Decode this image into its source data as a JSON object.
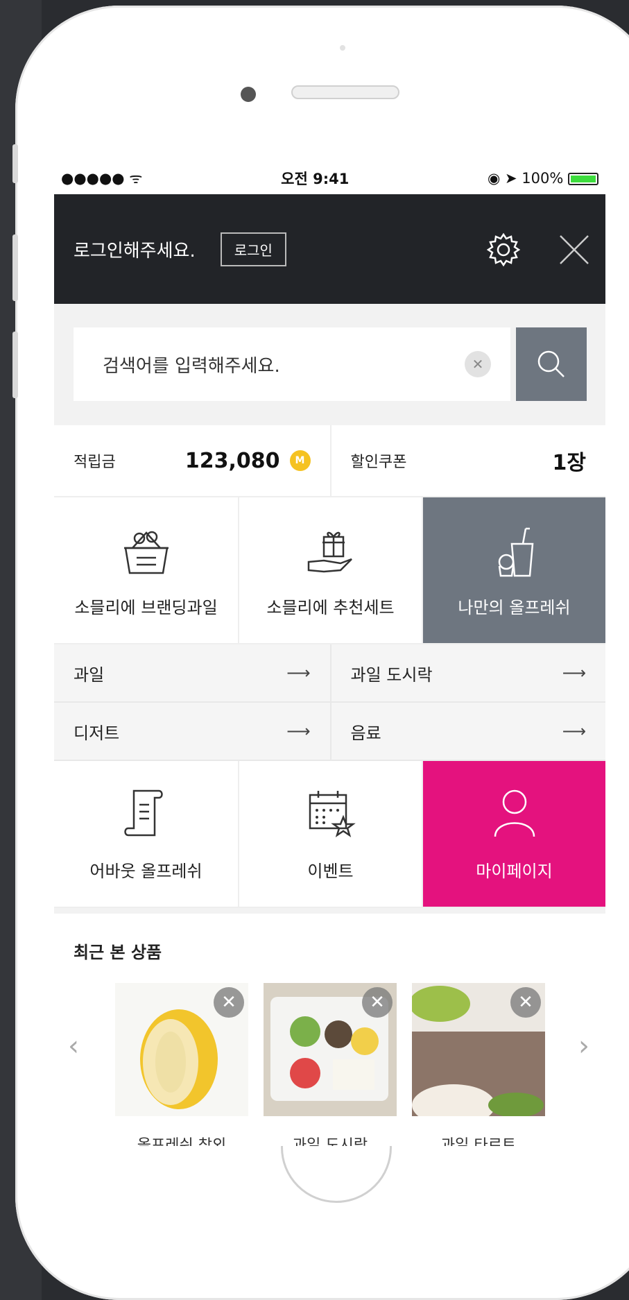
{
  "status_bar": {
    "signal": "●●●●● ᯤ",
    "time": "오전 9:41",
    "battery": "100%"
  },
  "header": {
    "greeting": "로그인해주세요.",
    "login_label": "로그인"
  },
  "search": {
    "placeholder": "검색어를 입력해주세요."
  },
  "points": {
    "label": "적립금",
    "value": "123,080",
    "coin_icon": "M"
  },
  "coupon": {
    "label": "할인쿠폰",
    "value": "1장"
  },
  "menu_top": [
    {
      "label": "소믈리에 브랜딩과일",
      "icon": "basket-icon"
    },
    {
      "label": "소믈리에 추천세트",
      "icon": "gift-hand-icon"
    },
    {
      "label": "나만의 올프레쉬",
      "icon": "drink-icon"
    }
  ],
  "categories": [
    {
      "label": "과일",
      "arrow": "⟶"
    },
    {
      "label": "과일 도시락",
      "arrow": "⟶"
    },
    {
      "label": "디저트",
      "arrow": "⟶"
    },
    {
      "label": "음료",
      "arrow": "⟶"
    }
  ],
  "menu_bottom": [
    {
      "label": "어바웃 올프레쉬",
      "icon": "scroll-icon"
    },
    {
      "label": "이벤트",
      "icon": "calendar-star-icon"
    },
    {
      "label": "마이페이지",
      "icon": "person-icon"
    }
  ],
  "recent": {
    "title": "최근 본 상품",
    "items": [
      {
        "name": "올프레쉬 참외"
      },
      {
        "name": "과일 도시락"
      },
      {
        "name": "과일 타르트"
      }
    ]
  },
  "colors": {
    "accent_pink": "#e4127e",
    "header_dark": "#222428",
    "tile_gray": "#6e7680",
    "coin_yellow": "#f5c221"
  }
}
